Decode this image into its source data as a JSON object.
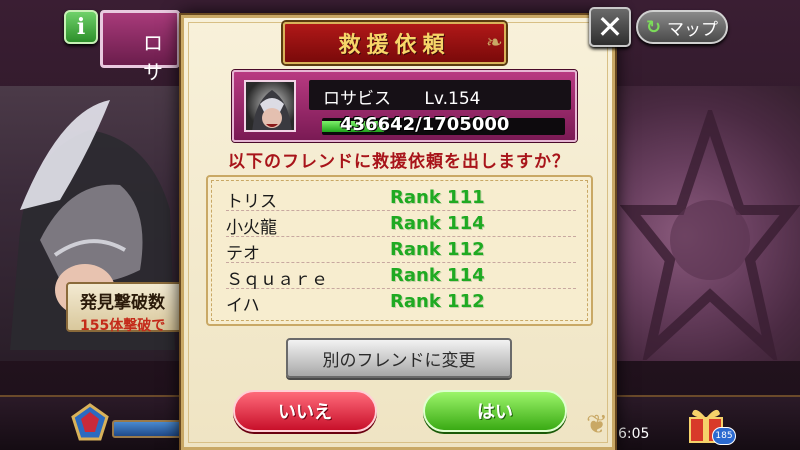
{
  "header": {
    "info_label": "i",
    "plate_text": "ロサ"
  },
  "map_button": {
    "label": "マップ",
    "icon": "refresh-icon"
  },
  "discover_plate": {
    "title": "発見撃破数",
    "subtitle": "155体撃破で"
  },
  "dialog": {
    "title": "救援依頼",
    "close_icon": "close-icon",
    "boss": {
      "name": "ロサビス",
      "level": "Lv.154",
      "hp_text": "436642/1705000",
      "hp_current": 436642,
      "hp_max": 1705000
    },
    "question": "以下のフレンドに救援依頼を出しますか？",
    "friends": [
      {
        "name": "トリス",
        "rank": "Rank 111"
      },
      {
        "name": "小火龍",
        "rank": "Rank 114"
      },
      {
        "name": "テオ",
        "rank": "Rank 112"
      },
      {
        "name": "Ｓｑｕａｒｅ",
        "rank": "Rank 114"
      },
      {
        "name": "イハ",
        "rank": "Rank 112"
      }
    ],
    "change_button": "別のフレンドに変更",
    "no_button": "いいえ",
    "yes_button": "はい"
  },
  "bottom_bar": {
    "timer": "6:05",
    "badge": "185"
  },
  "colors": {
    "accent_red": "#b01818",
    "rank_green": "#1faa22",
    "gold": "#c9a865"
  }
}
